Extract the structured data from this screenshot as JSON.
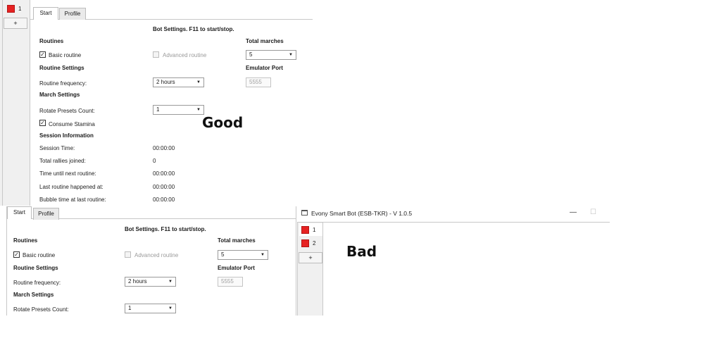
{
  "top": {
    "sidebar": {
      "instance_label": "1",
      "add_label": "+"
    },
    "tabs": [
      "Start",
      "Profile"
    ],
    "heading": "Bot Settings. F11 to start/stop.",
    "routines_title": "Routines",
    "basic_routine": "Basic routine",
    "advanced_routine": "Advanced routine",
    "total_marches_title": "Total marches",
    "total_marches_value": "5",
    "routine_settings_title": "Routine Settings",
    "emulator_port_title": "Emulator Port",
    "routine_frequency_label": "Routine frequency:",
    "routine_frequency_value": "2 hours",
    "emulator_port_placeholder": "5555",
    "march_settings_title": "March Settings",
    "rotate_presets_label": "Rotate Presets Count:",
    "rotate_presets_value": "1",
    "consume_stamina": "Consume Stamina",
    "session_info_title": "Session Information",
    "session_rows": [
      {
        "label": "Session Time:",
        "value": "00:00:00"
      },
      {
        "label": "Total rallies joined:",
        "value": "0"
      },
      {
        "label": "Time until next routine:",
        "value": "00:00:00"
      },
      {
        "label": "Last routine happened at:",
        "value": "00:00:00"
      },
      {
        "label": "Bubble time at last routine:",
        "value": "00:00:00"
      }
    ],
    "annotation": "Good"
  },
  "bottom_left": {
    "tabs": [
      "Start",
      "Profile"
    ],
    "heading": "Bot Settings. F11 to start/stop.",
    "routines_title": "Routines",
    "basic_routine": "Basic routine",
    "advanced_routine": "Advanced routine",
    "total_marches_title": "Total marches",
    "total_marches_value": "5",
    "routine_settings_title": "Routine Settings",
    "emulator_port_title": "Emulator Port",
    "routine_frequency_label": "Routine frequency:",
    "routine_frequency_value": "2 hours",
    "emulator_port_placeholder": "5555",
    "march_settings_title": "March Settings",
    "rotate_presets_label": "Rotate Presets Count:",
    "rotate_presets_value": "1"
  },
  "bottom_right": {
    "window_title": "Evony Smart Bot (ESB-TKR) - V 1.0.5",
    "minimize_label": "—",
    "maximize_label": "☐",
    "instances": [
      "1",
      "2"
    ],
    "add_label": "+",
    "annotation": "Bad"
  },
  "colors": {
    "instance_red": "#e62222",
    "panel_gray": "#f0f0f0",
    "border": "#c8c8c8"
  },
  "icons": {
    "check": "✓",
    "dropdown_arrow": "▼",
    "app_icon": "window-icon"
  }
}
